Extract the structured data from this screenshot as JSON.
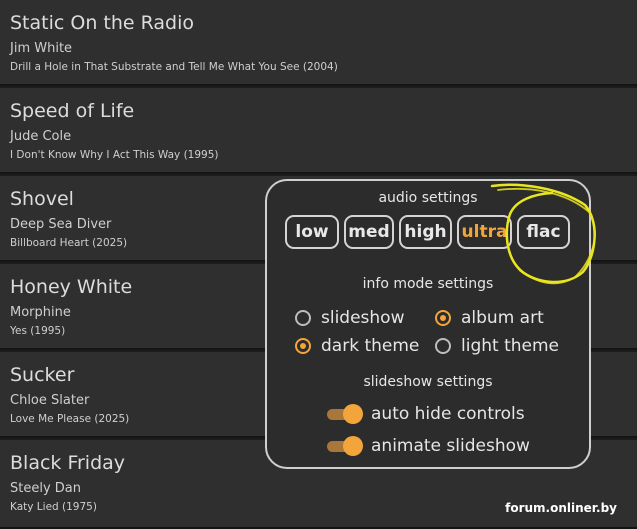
{
  "tracks": [
    {
      "title": "Static On the Radio",
      "artist": "Jim White",
      "album": "Drill a Hole in That Substrate and Tell Me What You See (2004)"
    },
    {
      "title": "Speed of Life",
      "artist": "Jude Cole",
      "album": "I Don't Know Why I Act This Way (1995)"
    },
    {
      "title": "Shovel",
      "artist": "Deep Sea Diver",
      "album": "Billboard Heart (2025)"
    },
    {
      "title": "Honey White",
      "artist": "Morphine",
      "album": "Yes (1995)"
    },
    {
      "title": "Sucker",
      "artist": "Chloe Slater",
      "album": "Love Me Please (2025)"
    },
    {
      "title": "Black Friday",
      "artist": "Steely Dan",
      "album": "Katy Lied (1975)"
    }
  ],
  "settings": {
    "audio_title": "audio settings",
    "quality_options": [
      "low",
      "med",
      "high",
      "ultra",
      "flac"
    ],
    "selected_quality": "ultra",
    "info_title": "info mode settings",
    "info_options": [
      {
        "label": "slideshow",
        "selected": false
      },
      {
        "label": "album art",
        "selected": true
      },
      {
        "label": "dark theme",
        "selected": true
      },
      {
        "label": "light theme",
        "selected": false
      }
    ],
    "slideshow_title": "slideshow settings",
    "toggles": [
      {
        "label": "auto hide controls",
        "on": true
      },
      {
        "label": "animate slideshow",
        "on": true
      }
    ]
  },
  "colors": {
    "accent": "#f3a53c",
    "annotation": "#e9e51f"
  },
  "watermark": "forum.onliner.by"
}
